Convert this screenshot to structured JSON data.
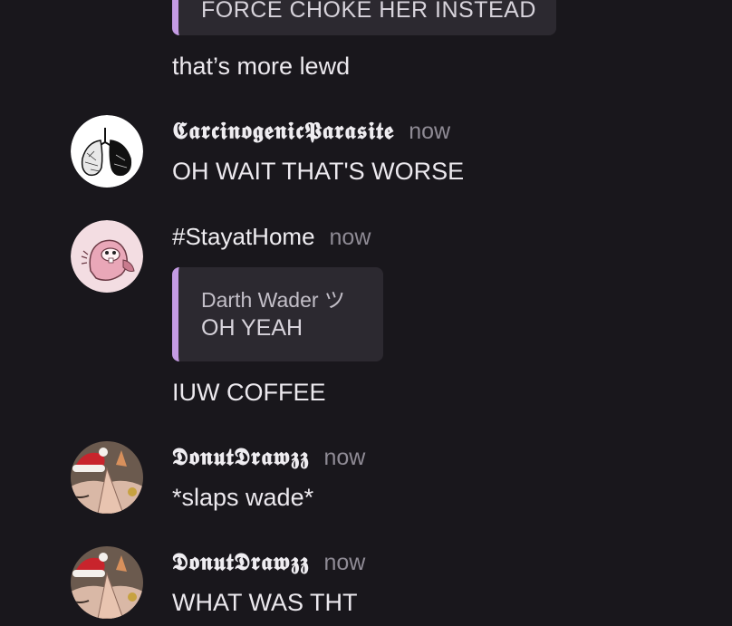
{
  "messages": {
    "m0": {
      "quote_text": "FORCE CHOKE HER INSTEAD",
      "text": "that’s more lewd"
    },
    "m1": {
      "author": "𝕮𝖆𝖗𝖈𝖎𝖓𝖔𝖌𝖊𝖓𝖎𝖈𝕻𝖆𝖗𝖆𝖘𝖎𝖙𝖊",
      "time": "now",
      "text": "OH WAIT THAT'S WORSE",
      "avatar_icon": "lungs-drawing-avatar"
    },
    "m2": {
      "author": "#StayatHome",
      "time": "now",
      "quote_author": "Darth Wader ツ",
      "quote_text": "OH YEAH",
      "text": "IUW COFFEE",
      "avatar_icon": "cartoon-beaver-avatar"
    },
    "m3": {
      "author": "𝕯𝖔𝖓𝖚𝖙𝕯𝖗𝖆𝖜𝖟𝖟",
      "time": "now",
      "text": "*slaps wade*",
      "avatar_icon": "santa-hat-character-avatar"
    },
    "m4": {
      "author": "𝕯𝖔𝖓𝖚𝖙𝕯𝖗𝖆𝖜𝖟𝖟",
      "time": "now",
      "text": "WHAT WAS THT",
      "avatar_icon": "santa-hat-character-avatar"
    }
  },
  "colors": {
    "background": "#19171c",
    "quote_bar": "#c49be3",
    "quote_bg": "#2c2930",
    "timestamp": "#8f8b95"
  }
}
